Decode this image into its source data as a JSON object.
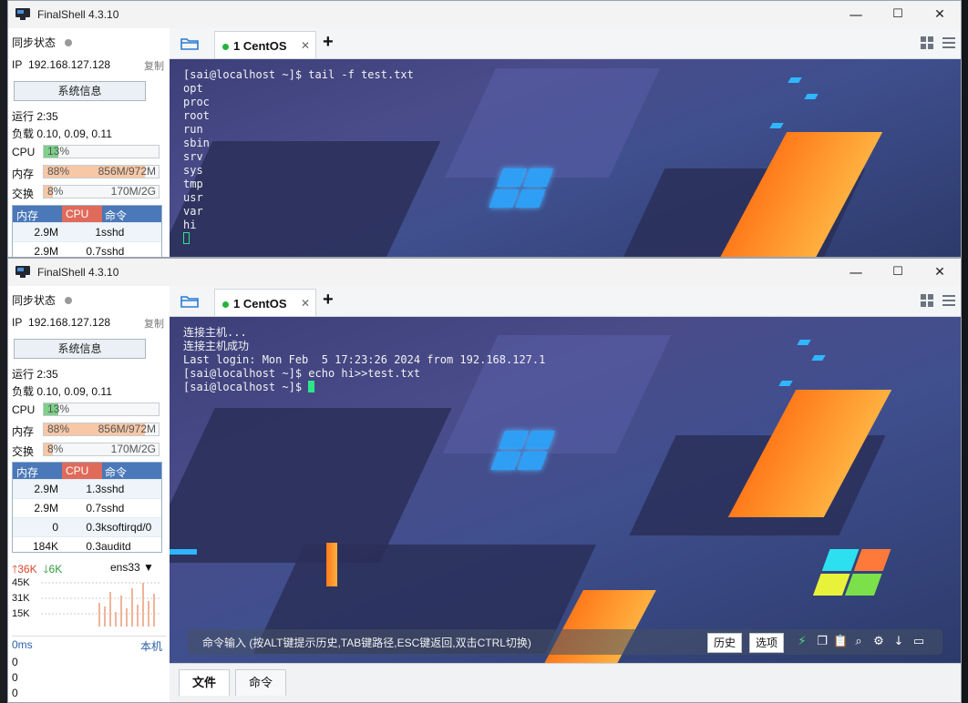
{
  "app": {
    "title": "FinalShell 4.3.10"
  },
  "sidebar": {
    "sync_label": "同步状态",
    "ip_label": "IP",
    "ip": "192.168.127.128",
    "copy": "复制",
    "sysinfo_button": "系统信息",
    "uptime_label": "运行",
    "uptime": "2:35",
    "load_label": "负载",
    "load": "0.10, 0.09, 0.11",
    "cpu": {
      "label": "CPU",
      "percent": "13%",
      "value": 0.13
    },
    "mem": {
      "label": "内存",
      "percent": "88%",
      "detail": "856M/972M",
      "value": 0.88
    },
    "swap": {
      "label": "交换",
      "percent": "8%",
      "detail": "170M/2G",
      "value": 0.08
    },
    "proc_headers": {
      "mem": "内存",
      "cpu": "CPU",
      "cmd": "命令"
    },
    "processes_top": [
      {
        "mem": "2.9M",
        "cpu": "1",
        "cmd": "sshd"
      },
      {
        "mem": "2.9M",
        "cpu": "0.7",
        "cmd": "sshd"
      }
    ],
    "processes": [
      {
        "mem": "2.9M",
        "cpu": "1.3",
        "cmd": "sshd"
      },
      {
        "mem": "2.9M",
        "cpu": "0.7",
        "cmd": "sshd"
      },
      {
        "mem": "0",
        "cpu": "0.3",
        "cmd": "ksoftirqd/0"
      },
      {
        "mem": "184K",
        "cpu": "0.3",
        "cmd": "auditd"
      }
    ],
    "net": {
      "up": "36K",
      "down": "6K",
      "iface": "ens33",
      "scale": [
        "45K",
        "31K",
        "15K"
      ]
    },
    "latency": {
      "label": "0ms",
      "host": "本机",
      "values": [
        "0",
        "0",
        "0"
      ]
    }
  },
  "tab": {
    "label": "1 CentOS"
  },
  "terminal_top": {
    "lines": [
      "[sai@localhost ~]$ tail -f test.txt",
      "opt",
      "proc",
      "root",
      "run",
      "sbin",
      "srv",
      "sys",
      "tmp",
      "usr",
      "var",
      "hi"
    ]
  },
  "terminal_bottom": {
    "lines": [
      "连接主机...",
      "连接主机成功",
      "Last login: Mon Feb  5 17:23:26 2024 from 192.168.127.1",
      "[sai@localhost ~]$ echo hi>>test.txt",
      "[sai@localhost ~]$ "
    ]
  },
  "cmdbar": {
    "hint": "命令输入 (按ALT键提示历史,TAB键路径,ESC键返回,双击CTRL切换)",
    "history": "历史",
    "options": "选项"
  },
  "bottom_tabs": [
    "文件",
    "命令"
  ],
  "colors": {
    "cpu_fill": "#7ed08a",
    "mem_fill": "#f7c7a6",
    "swap_fill": "#f7c7a6",
    "proc_header": "#4a78b8",
    "proc_cpu_header": "#e06b5b",
    "online_dot": "#22b43c"
  }
}
